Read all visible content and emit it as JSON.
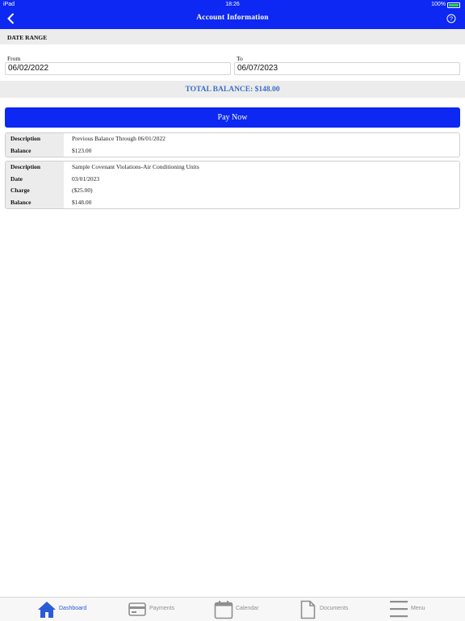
{
  "status_bar": {
    "device": "iPad",
    "time": "18:26",
    "battery": "100%"
  },
  "header": {
    "title": "Account Information"
  },
  "date_range": {
    "label": "DATE RANGE",
    "from_label": "From",
    "from_value": "06/02/2022",
    "to_label": "To",
    "to_value": "06/07/2023"
  },
  "total": {
    "text": "TOTAL BALANCE: $148.00"
  },
  "pay_button": {
    "label": "Pay Now"
  },
  "transactions": [
    {
      "rows": [
        {
          "label": "Description",
          "value": "Previous Balance Through 06/01/2022"
        },
        {
          "label": "Balance",
          "value": "$123.00"
        }
      ]
    },
    {
      "rows": [
        {
          "label": "Description",
          "value": "Sample Covenant Violations-Air Conditioning Units"
        },
        {
          "label": "Date",
          "value": "03/01/2023"
        },
        {
          "label": "Charge",
          "value": "($25.00)"
        },
        {
          "label": "Balance",
          "value": "$148.00"
        }
      ]
    }
  ],
  "tabs": [
    {
      "label": "Dashboard",
      "icon": "home-icon",
      "active": true
    },
    {
      "label": "Payments",
      "icon": "credit-card-icon",
      "active": false
    },
    {
      "label": "Calendar",
      "icon": "calendar-icon",
      "active": false
    },
    {
      "label": "Documents",
      "icon": "document-icon",
      "active": false
    },
    {
      "label": "Menu",
      "icon": "menu-icon",
      "active": false
    }
  ],
  "colors": {
    "nav_blue": "#0d28f2",
    "total_text": "#3a6ec4",
    "tab_active": "#2a5bd7",
    "battery_green": "#2bd64c"
  }
}
